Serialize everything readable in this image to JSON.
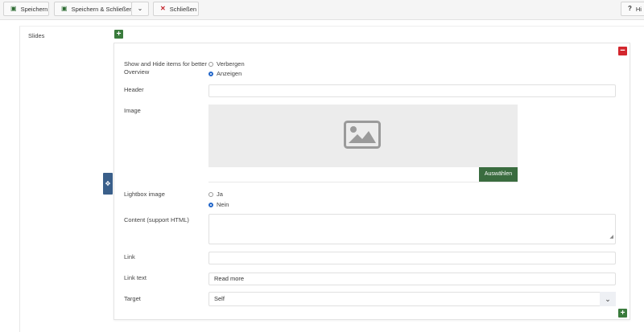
{
  "toolbar": {
    "save_label": "Speichern",
    "save_close_label": "Speichern & Schließen",
    "close_label": "Schließen",
    "help_label": "Hi"
  },
  "slides": {
    "label": "Slides",
    "add_symbol": "+",
    "remove_symbol": "−"
  },
  "fields": {
    "show_hide": {
      "label": "Show and Hide items for better Overview",
      "options": [
        {
          "label": "Verbergen",
          "checked": false
        },
        {
          "label": "Anzeigen",
          "checked": true
        }
      ]
    },
    "header": {
      "label": "Header",
      "value": ""
    },
    "image": {
      "label": "Image",
      "choose_label": "Auswählen"
    },
    "lightbox": {
      "label": "Lightbox image",
      "options": [
        {
          "label": "Ja",
          "checked": false
        },
        {
          "label": "Nein",
          "checked": true
        }
      ]
    },
    "content": {
      "label": "Content (support HTML)",
      "value": ""
    },
    "link": {
      "label": "Link",
      "value": ""
    },
    "link_text": {
      "label": "Link text",
      "value": "Read more"
    },
    "target": {
      "label": "Target",
      "value": "Self"
    }
  },
  "icons": {
    "save": "floppy-disk-icon",
    "close": "x-icon",
    "chevron": "chevron-down-icon",
    "drag": "move-icon",
    "image": "image-placeholder-icon"
  },
  "colors": {
    "add": "#3a7b3c",
    "remove": "#d3262d",
    "choose_button": "#3a6c3f",
    "radio_checked": "#2467c9",
    "drag_handle": "#3a5f8a"
  }
}
